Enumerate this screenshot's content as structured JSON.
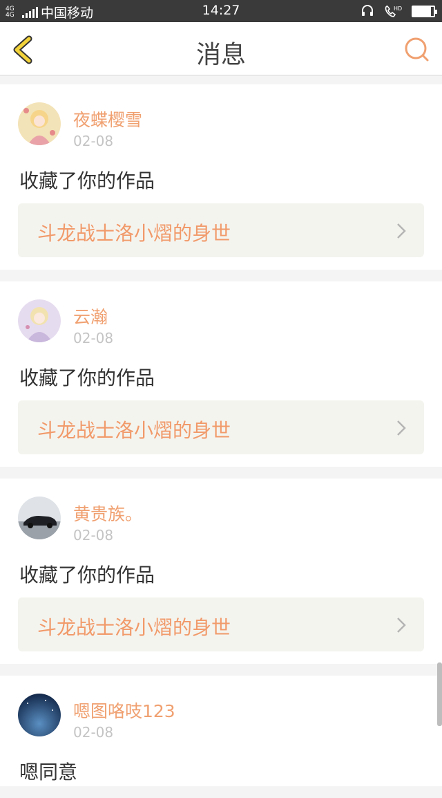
{
  "status_bar": {
    "network": "4G 4G",
    "carrier": "中国移动",
    "time": "14:27",
    "battery_level": 0.85
  },
  "header": {
    "title": "消息",
    "back_icon": "back-chevron-icon",
    "search_icon": "search-icon",
    "accent_color": "#f0a070"
  },
  "messages": [
    {
      "user": "夜蝶樱雪",
      "date": "02-08",
      "action": "收藏了你的作品",
      "work_title": "斗龙战士洛小熠的身世"
    },
    {
      "user": "云瀚",
      "date": "02-08",
      "action": "收藏了你的作品",
      "work_title": "斗龙战士洛小熠的身世"
    },
    {
      "user": "黄贵族。",
      "date": "02-08",
      "action": "收藏了你的作品",
      "work_title": "斗龙战士洛小熠的身世"
    },
    {
      "user": "嗯图咯吱123",
      "date": "02-08",
      "action": "嗯同意"
    }
  ]
}
